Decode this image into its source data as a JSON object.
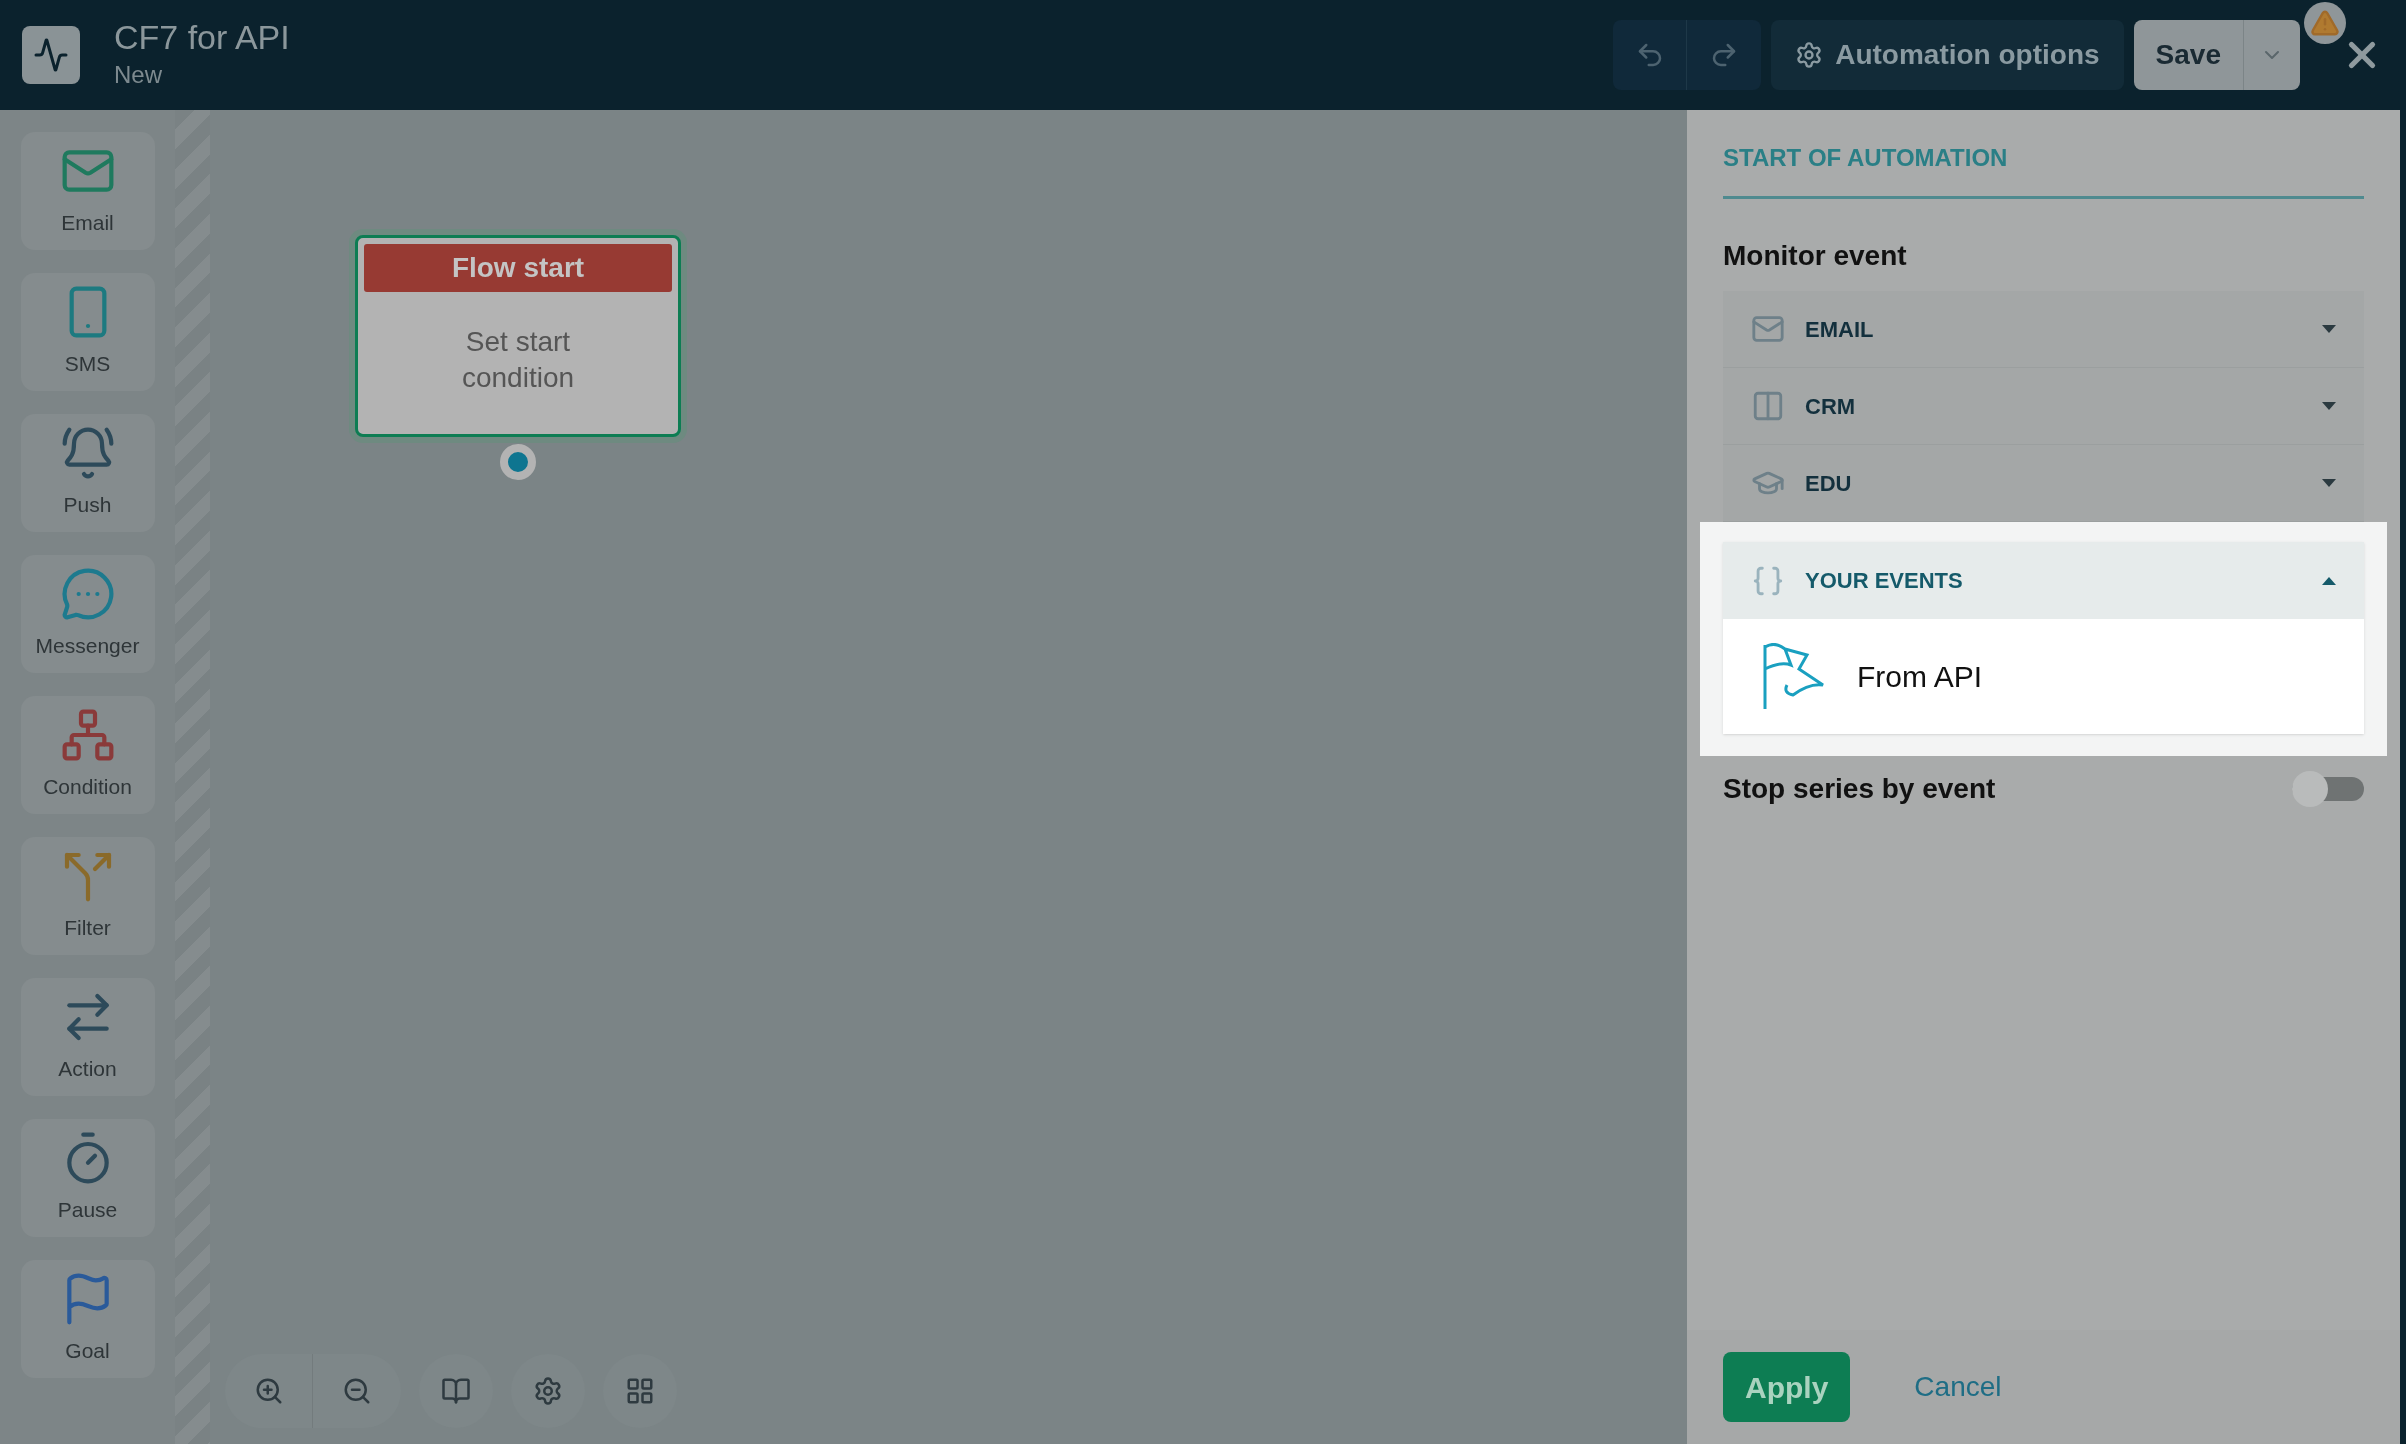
{
  "header": {
    "title": "CF7 for API",
    "subtitle": "New",
    "options_button": "Automation options",
    "save_button": "Save",
    "warning": true
  },
  "palette": [
    {
      "label": "Email"
    },
    {
      "label": "SMS"
    },
    {
      "label": "Push"
    },
    {
      "label": "Messenger"
    },
    {
      "label": "Condition"
    },
    {
      "label": "Filter"
    },
    {
      "label": "Action"
    },
    {
      "label": "Pause"
    },
    {
      "label": "Goal"
    }
  ],
  "node": {
    "title": "Flow start",
    "body": "Set start condition"
  },
  "panel": {
    "title": "START OF AUTOMATION",
    "section": "Monitor event",
    "events": [
      {
        "label": "EMAIL",
        "expanded": false
      },
      {
        "label": "CRM",
        "expanded": false
      },
      {
        "label": "EDU",
        "expanded": false
      },
      {
        "label": "YOUR EVENTS",
        "expanded": true,
        "children": [
          {
            "label": "From API"
          }
        ]
      }
    ],
    "stop_series": {
      "label": "Stop series by event",
      "on": false
    },
    "apply": "Apply",
    "cancel": "Cancel"
  }
}
